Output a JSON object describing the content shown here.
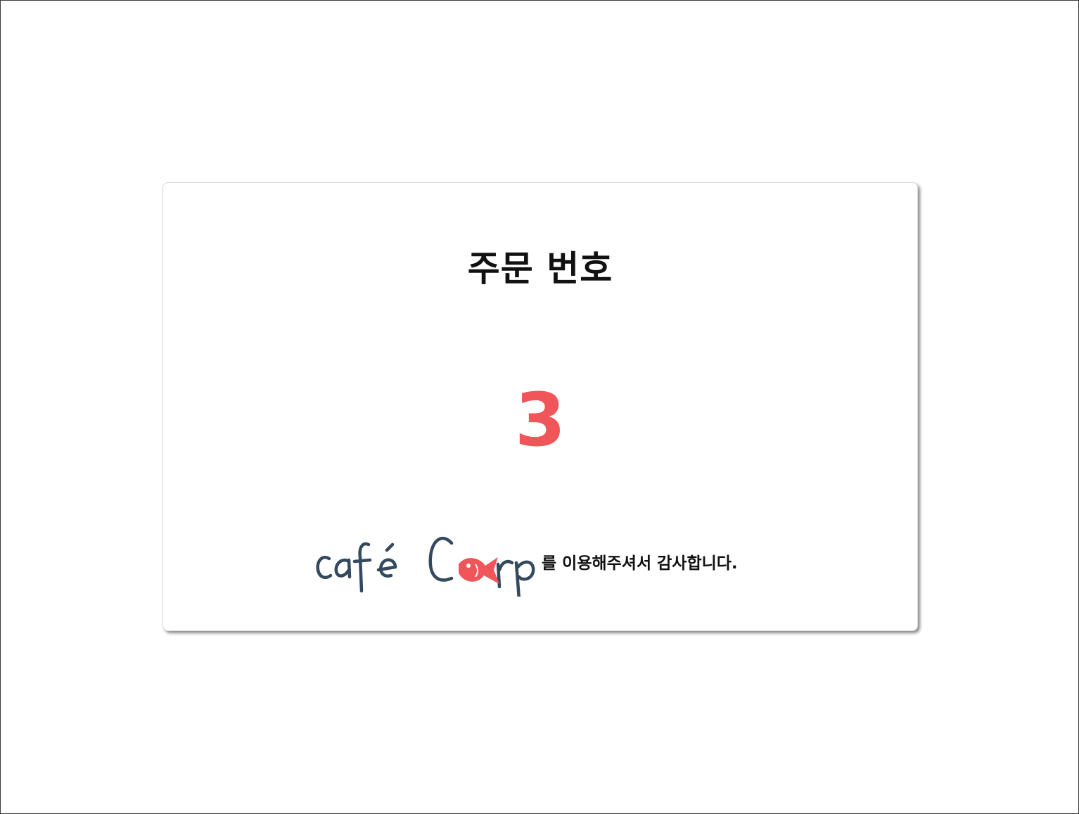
{
  "order": {
    "title": "주문 번호",
    "number": "3"
  },
  "footer": {
    "logo_text": "café Carp",
    "thanks": "를 이용해주셔서 감사합니다."
  },
  "colors": {
    "accent": "#f0555a",
    "logo_ink": "#34495e",
    "text": "#111111"
  },
  "icons": {
    "logo": "cafe-carp-logo",
    "fish": "fish-icon"
  }
}
